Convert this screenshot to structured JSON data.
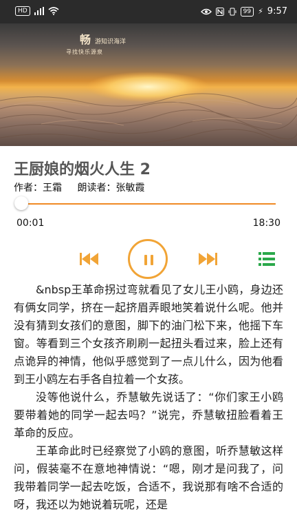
{
  "status_bar": {
    "left_icons": [
      "hd-icon",
      "signal-icon",
      "wifi-icon"
    ],
    "hd_label": "HD",
    "right_icons": [
      "eye-icon",
      "nfc-icon",
      "vibrate-icon",
      "battery-icon",
      "charging-icon"
    ],
    "battery": "99",
    "time": "9:57"
  },
  "banner": {
    "caption_main": "畅",
    "caption_small": "游知识海洋",
    "caption_sub": "寻找快乐源泉"
  },
  "book": {
    "title": "王厨娘的烟火人生 2",
    "author": "作者：王霜",
    "reader": "朗读者：张敏霞"
  },
  "player": {
    "current_time": "00:01",
    "total_time": "18:30",
    "progress_fraction": 0.001,
    "accent_color": "#f1a436",
    "list_color": "#2aa84a"
  },
  "article": {
    "paragraphs": [
      "&nbsp王革命拐过弯就看见了女儿王小鸥，身边还有俩女同学，挤在一起挤眉弄眼地笑着说什么呢。他并没有猜到女孩们的意图，脚下的油门松下来，他摇下车窗。等看到三个女孩齐刷刷一起扭头看过来，脸上还有点诡异的神情，他似乎感觉到了一点儿什么，因为他看到王小鸥左右手各自拉着一个女孩。",
      "没等他说什么，乔慧敏先说话了：“你们家王小鸥要带着她的同学一起去吗？”说完，乔慧敏扭脸看着王革命的反应。",
      "王革命此时已经察觉了小鸥的意图，听乔慧敏这样问，假装毫不在意地神情说：“嗯，刚才是问我了，问我带着同学一起去吃饭，合适不，我说那有啥不合适的呀，我还以为她说着玩呢，还是"
    ]
  }
}
